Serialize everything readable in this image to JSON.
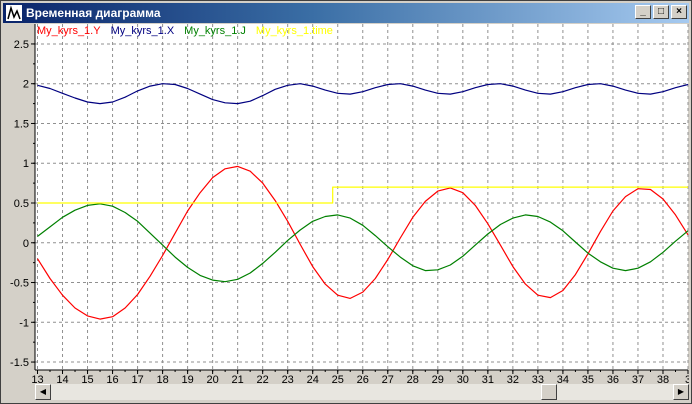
{
  "window": {
    "title": "Временная диаграмма",
    "buttons": [
      "_",
      "□",
      "×"
    ]
  },
  "legend": [
    {
      "label": "My_kyrs_1.Y",
      "color": "#ff0000"
    },
    {
      "label": "My_kyrs_1.X",
      "color": "#000080"
    },
    {
      "label": "My_kyrs_1.J",
      "color": "#008000"
    },
    {
      "label": "My_kyrs_1.time",
      "color": "#ffff00"
    }
  ],
  "chart_data": {
    "type": "line",
    "xlim": [
      12.9,
      39
    ],
    "ylim": [
      -1.6,
      2.6
    ],
    "y_ticks": [
      "2.5",
      "2",
      "1.5",
      "1",
      "0.5",
      "0",
      "-0.5",
      "-1",
      "-1.5"
    ],
    "x_ticks": [
      "13",
      "14",
      "15",
      "16",
      "17",
      "18",
      "19",
      "20",
      "21",
      "22",
      "23",
      "24",
      "25",
      "26",
      "27",
      "28",
      "29",
      "30",
      "31",
      "32",
      "33",
      "34",
      "35",
      "36",
      "37",
      "38",
      "3"
    ],
    "grid": true,
    "legend_placement": "top-left",
    "series": [
      {
        "name": "My_kyrs_1.Y",
        "color": "#ff0000",
        "x": [
          13,
          13.5,
          14,
          14.5,
          15,
          15.5,
          16,
          16.5,
          17,
          17.5,
          18,
          18.5,
          19,
          19.5,
          20,
          20.5,
          21,
          21.5,
          22,
          22.5,
          23,
          23.5,
          24,
          24.5,
          25,
          25.5,
          26,
          26.5,
          27,
          27.5,
          28,
          28.5,
          29,
          29.5,
          30,
          30.5,
          31,
          31.5,
          32,
          32.5,
          33,
          33.5,
          34,
          34.5,
          35,
          35.5,
          36,
          36.5,
          37,
          37.5,
          38,
          38.5,
          39
        ],
        "y": [
          -0.2,
          -0.45,
          -0.66,
          -0.82,
          -0.92,
          -0.96,
          -0.93,
          -0.82,
          -0.65,
          -0.42,
          -0.16,
          0.12,
          0.4,
          0.63,
          0.82,
          0.93,
          0.96,
          0.9,
          0.75,
          0.53,
          0.27,
          -0.02,
          -0.3,
          -0.52,
          -0.66,
          -0.7,
          -0.62,
          -0.45,
          -0.21,
          0.06,
          0.32,
          0.52,
          0.65,
          0.69,
          0.63,
          0.47,
          0.24,
          -0.03,
          -0.3,
          -0.52,
          -0.66,
          -0.69,
          -0.6,
          -0.4,
          -0.14,
          0.14,
          0.4,
          0.58,
          0.68,
          0.67,
          0.55,
          0.35,
          0.1
        ]
      },
      {
        "name": "My_kyrs_1.X",
        "color": "#000080",
        "x": [
          13,
          13.5,
          14,
          14.5,
          15,
          15.5,
          16,
          16.5,
          17,
          17.5,
          18,
          18.5,
          19,
          19.5,
          20,
          20.5,
          21,
          21.5,
          22,
          22.5,
          23,
          23.5,
          24,
          24.5,
          25,
          25.5,
          26,
          26.5,
          27,
          27.5,
          28,
          28.5,
          29,
          29.5,
          30,
          30.5,
          31,
          31.5,
          32,
          32.5,
          33,
          33.5,
          34,
          34.5,
          35,
          35.5,
          36,
          36.5,
          37,
          37.5,
          38,
          38.5,
          39
        ],
        "y": [
          1.98,
          1.94,
          1.88,
          1.82,
          1.77,
          1.75,
          1.77,
          1.83,
          1.91,
          1.97,
          2.0,
          1.99,
          1.94,
          1.87,
          1.8,
          1.76,
          1.75,
          1.78,
          1.85,
          1.93,
          1.98,
          2.0,
          1.97,
          1.92,
          1.88,
          1.87,
          1.9,
          1.95,
          1.99,
          2.0,
          1.97,
          1.92,
          1.88,
          1.87,
          1.9,
          1.95,
          1.99,
          2.0,
          1.97,
          1.92,
          1.88,
          1.87,
          1.9,
          1.95,
          1.99,
          2.0,
          1.97,
          1.92,
          1.88,
          1.87,
          1.9,
          1.95,
          1.99
        ]
      },
      {
        "name": "My_kyrs_1.J",
        "color": "#008000",
        "x": [
          13,
          13.5,
          14,
          14.5,
          15,
          15.5,
          16,
          16.5,
          17,
          17.5,
          18,
          18.5,
          19,
          19.5,
          20,
          20.5,
          21,
          21.5,
          22,
          22.5,
          23,
          23.5,
          24,
          24.5,
          25,
          25.5,
          26,
          26.5,
          27,
          27.5,
          28,
          28.5,
          29,
          29.5,
          30,
          30.5,
          31,
          31.5,
          32,
          32.5,
          33,
          33.5,
          34,
          34.5,
          35,
          35.5,
          36,
          36.5,
          37,
          37.5,
          38,
          38.5,
          39
        ],
        "y": [
          0.08,
          0.2,
          0.32,
          0.41,
          0.47,
          0.49,
          0.46,
          0.38,
          0.27,
          0.12,
          -0.03,
          -0.18,
          -0.31,
          -0.41,
          -0.47,
          -0.49,
          -0.46,
          -0.38,
          -0.26,
          -0.12,
          0.03,
          0.16,
          0.27,
          0.33,
          0.35,
          0.31,
          0.22,
          0.09,
          -0.05,
          -0.18,
          -0.29,
          -0.35,
          -0.34,
          -0.28,
          -0.17,
          -0.03,
          0.11,
          0.23,
          0.31,
          0.35,
          0.33,
          0.26,
          0.15,
          0.01,
          -0.13,
          -0.24,
          -0.32,
          -0.35,
          -0.32,
          -0.24,
          -0.12,
          0.02,
          0.15
        ]
      },
      {
        "name": "My_kyrs_1.time",
        "color": "#ffff00",
        "x": [
          13,
          24.8,
          24.8,
          39
        ],
        "y": [
          0.5,
          0.5,
          0.7,
          0.7
        ]
      }
    ]
  }
}
